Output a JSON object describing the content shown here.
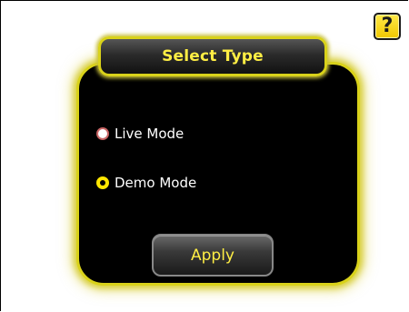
{
  "help": {
    "glyph": "?",
    "icon": "question-mark-icon"
  },
  "dialog": {
    "title": "Select Type",
    "options": [
      {
        "label": "Live Mode",
        "selected": false
      },
      {
        "label": "Demo Mode",
        "selected": true
      }
    ],
    "apply_label": "Apply"
  },
  "colors": {
    "accent_yellow": "#ffee44",
    "glow_border": "#d9d21a",
    "dialog_background": "#000000",
    "help_button": "#f5d400"
  }
}
